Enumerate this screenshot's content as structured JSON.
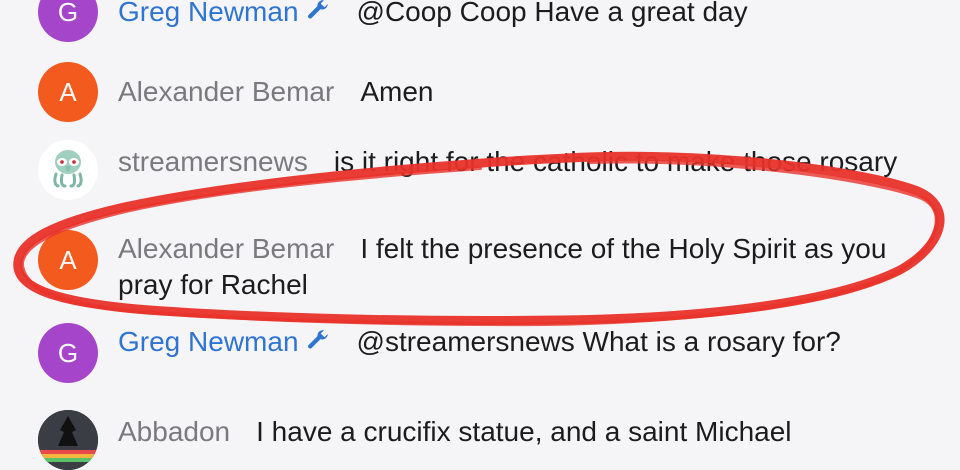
{
  "chat": {
    "messages": [
      {
        "avatar_letter": "G",
        "author": "Greg Newman",
        "is_moderator": true,
        "text": "@Coop Coop Have a great day"
      },
      {
        "avatar_letter": "A",
        "author": "Alexander Bemar",
        "is_moderator": false,
        "text": "Amen"
      },
      {
        "avatar_letter": "",
        "author": "streamersnews",
        "is_moderator": false,
        "text": "is it right for the catholic to make those rosary"
      },
      {
        "avatar_letter": "A",
        "author": "Alexander Bemar",
        "is_moderator": false,
        "text": "I felt the presence of the Holy Spirit as you pray for Rachel"
      },
      {
        "avatar_letter": "G",
        "author": "Greg Newman",
        "is_moderator": true,
        "text": "@streamersnews What is a rosary for?"
      },
      {
        "avatar_letter": "",
        "author": "Abbadon",
        "is_moderator": false,
        "text": "I have a crucifix statue, and a saint Michael"
      }
    ]
  },
  "colors": {
    "background": "#f5f5f7",
    "avatar_purple": "#a545c9",
    "avatar_orange": "#f25a1e",
    "moderator_name": "#2f74d0",
    "author_name": "#7a7a7e",
    "annotation_red": "#e8322a"
  },
  "icons": {
    "moderator_badge": "wrench-icon",
    "annotation": "red-marker-ellipse"
  }
}
